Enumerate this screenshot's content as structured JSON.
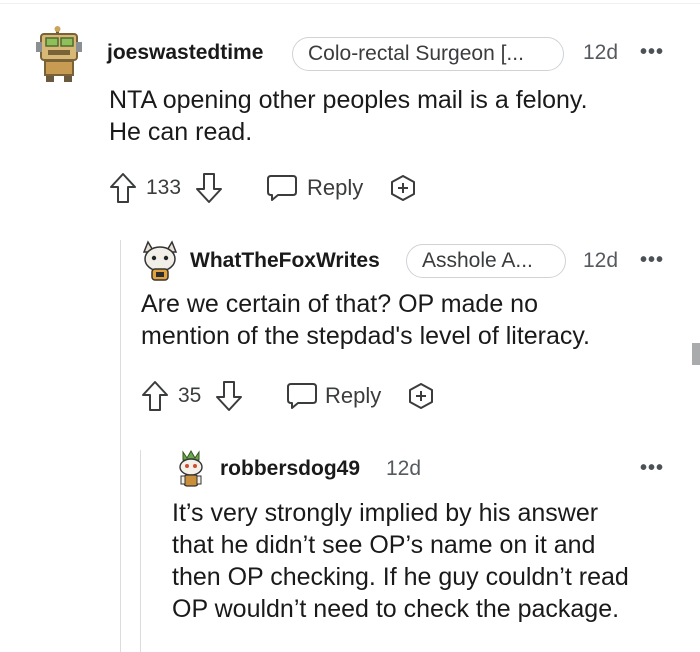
{
  "comments": [
    {
      "username": "joeswastedtime",
      "flair": "Colo-rectal Surgeon [...",
      "time": "12d",
      "more": "•••",
      "body": [
        "NTA opening other peoples mail is a felony.",
        "He can read."
      ],
      "votes": "133",
      "reply_label": "Reply",
      "avatar_icon": "robot-avatar-icon"
    },
    {
      "username": "WhatTheFoxWrites",
      "flair": "Asshole A...",
      "time": "12d",
      "more": "•••",
      "body": [
        "Are we certain of that? OP made no",
        "mention of the stepdad's level of literacy."
      ],
      "votes": "35",
      "reply_label": "Reply",
      "avatar_icon": "fox-avatar-icon"
    },
    {
      "username": "robbersdog49",
      "time": "12d",
      "more": "•••",
      "body": [
        "It’s very strongly implied by his answer",
        "that he didn’t see OP’s name on it and",
        "then OP checking. If he guy couldn’t read",
        "OP wouldn’t need to check the package."
      ],
      "avatar_icon": "snoo-avatar-icon"
    }
  ],
  "colors": {
    "text": "#1a1a1b",
    "muted": "#555a5f",
    "border": "#cfd3d6",
    "thread_line": "#dadde0"
  }
}
